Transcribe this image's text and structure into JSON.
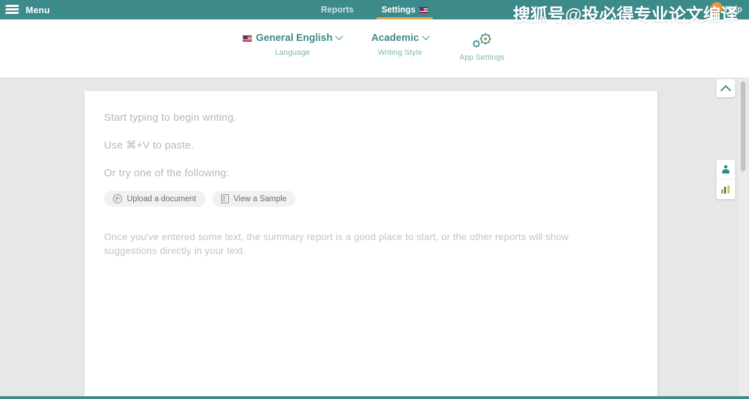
{
  "topbar": {
    "menu_label": "Menu",
    "logo_icon": "stacked-pages-logo",
    "nav": [
      {
        "label": "Reports",
        "active": false,
        "flag": false
      },
      {
        "label": "Settings",
        "active": true,
        "flag": true
      }
    ],
    "help_label": "Help",
    "accent_underline_color": "#e5a94e",
    "background_color": "#3c8b8a"
  },
  "watermark": {
    "text": "搜狐号@投必得专业论文编译"
  },
  "settings_bar": {
    "items": [
      {
        "value": "General English",
        "sublabel": "Language",
        "icon": "us-flag-icon",
        "has_chevron": true
      },
      {
        "value": "Academic",
        "sublabel": "Writing Style",
        "icon": "",
        "has_chevron": true
      },
      {
        "value": "",
        "sublabel": "App Settings",
        "icon": "gears-icon",
        "has_chevron": false
      }
    ],
    "teal_color": "#3c8b8a",
    "sub_color": "#7bb5b3"
  },
  "editor": {
    "placeholder_lines": [
      "Start typing to begin writing.",
      "Use ⌘+V to paste.",
      "Or try one of the following:"
    ],
    "buttons": [
      {
        "label": "Upload a document",
        "icon": "upload-circle-icon"
      },
      {
        "label": "View a Sample",
        "icon": "document-icon"
      }
    ],
    "hint": "Once you've entered some text, the summary report is a good place to start, or the other reports will show suggestions directly in your text."
  },
  "right_panel": {
    "collapse_icon": "chevron-up-icon",
    "tabs": [
      {
        "icon": "person-icon"
      },
      {
        "icon": "bar-chart-icon"
      }
    ]
  }
}
